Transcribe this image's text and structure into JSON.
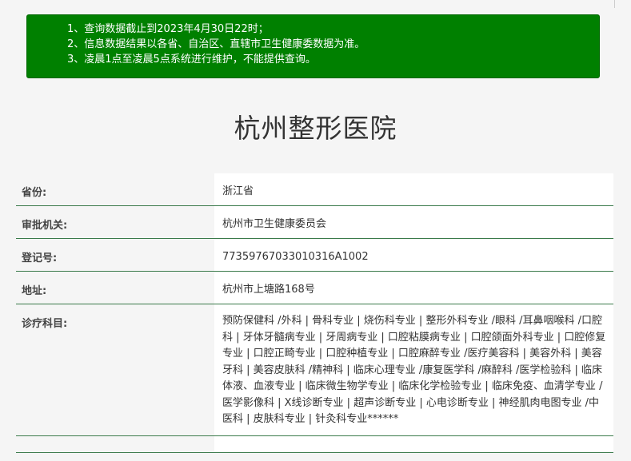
{
  "notice": {
    "lines": [
      "1、查询数据截止到2023年4月30日22时；",
      "2、信息数据结果以各省、自治区、直辖市卫生健康委数据为准。",
      "3、凌晨1点至凌晨5点系统进行维护，不能提供查询。"
    ]
  },
  "page_title": "杭州整形医院",
  "fields": {
    "province": {
      "label": "省份:",
      "value": "浙江省"
    },
    "authority": {
      "label": "审批机关:",
      "value": "杭州市卫生健康委员会"
    },
    "registration": {
      "label": "登记号:",
      "value": "77359767033010316A1002"
    },
    "address": {
      "label": "地址:",
      "value": "杭州市上塘路168号"
    },
    "departments": {
      "label": "诊疗科目:",
      "value": "预防保健科 /外科 | 骨科专业 | 烧伤科专业 | 整形外科专业 /眼科 /耳鼻咽喉科 /口腔科 | 牙体牙髓病专业 | 牙周病专业 | 口腔粘膜病专业 | 口腔颌面外科专业 | 口腔修复专业 | 口腔正畸专业 | 口腔种植专业 | 口腔麻醉专业 /医疗美容科 | 美容外科 | 美容牙科 | 美容皮肤科 /精神科 | 临床心理专业 /康复医学科 /麻醉科 /医学检验科 | 临床体液、血液专业 | 临床微生物学专业 | 临床化学检验专业 | 临床免疫、血清学专业 /医学影像科 | X线诊断专业 | 超声诊断专业 | 心电诊断专业 | 神经肌肉电图专业 /中医科 | 皮肤科专业 | 针灸科专业******"
    }
  },
  "colors": {
    "notice_bg": "#008000",
    "row_divider": "#3a7a4a",
    "page_bg": "#f5f5f5"
  }
}
